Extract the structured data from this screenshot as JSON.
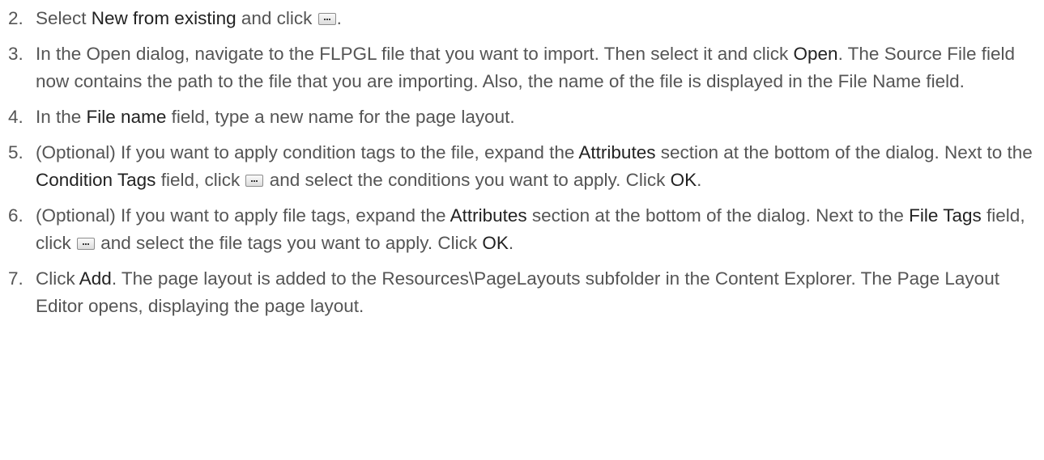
{
  "steps": [
    {
      "number": "2.",
      "parts": [
        "Select ",
        "New from existing",
        " and click ",
        "."
      ]
    },
    {
      "number": "3.",
      "parts": [
        "In the Open dialog, navigate to the FLPGL file that you want to import. Then select it and click ",
        "Open",
        ". The Source File field now contains the path to the file that you are importing. Also, the name of the file is displayed in the File Name field."
      ]
    },
    {
      "number": "4.",
      "parts": [
        "In the ",
        "File name",
        " field, type a new name for the page layout."
      ]
    },
    {
      "number": "5.",
      "parts": [
        "(Optional) If you want to apply condition tags to the file, expand the ",
        "Attributes",
        " section at the bottom of the dialog. Next to the ",
        "Condition Tags",
        " field, click ",
        " and select the conditions you want to apply. Click ",
        "OK",
        "."
      ]
    },
    {
      "number": "6.",
      "parts": [
        "(Optional) If you want to apply file tags, expand the ",
        "Attributes",
        " section at the bottom of the dialog. Next to the ",
        "File Tags",
        " field, click ",
        " and select the file tags you want to apply. Click ",
        "OK",
        "."
      ]
    },
    {
      "number": "7.",
      "parts": [
        "Click ",
        "Add",
        ". The page layout is added to the Resources\\PageLayouts subfolder in the Content Explorer. The Page Layout Editor opens, displaying the page layout."
      ]
    }
  ],
  "icons": {
    "browse_button": "ellipsis-button-icon"
  }
}
